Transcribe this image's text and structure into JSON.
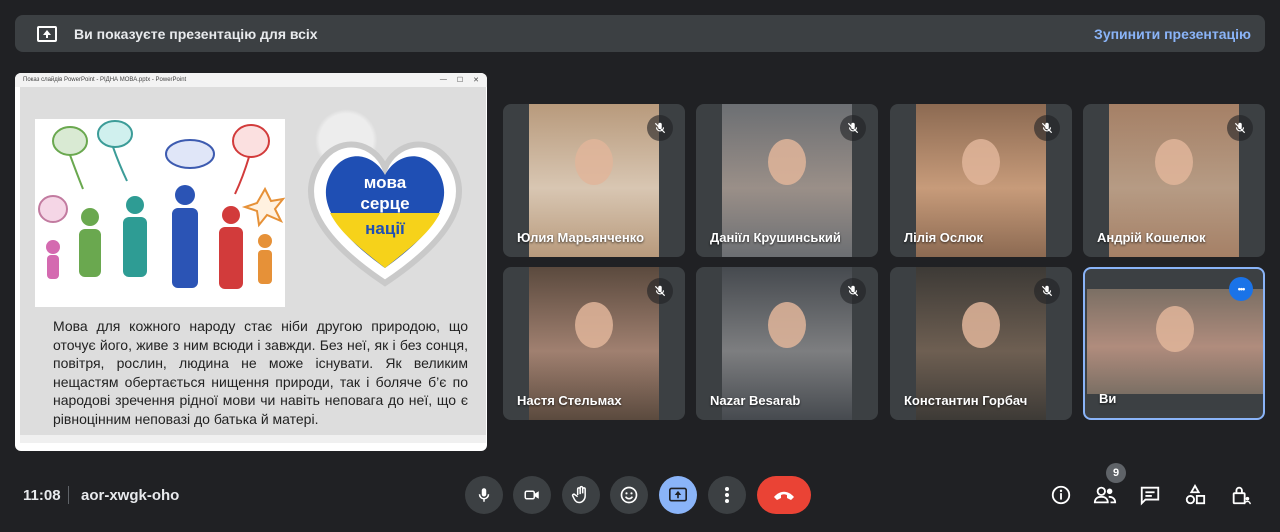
{
  "banner": {
    "text": "Ви показуєте презентацію для всіх",
    "stop_label": "Зупинити презентацію"
  },
  "presentation": {
    "window_title": "Показ слайдів PowerPoint - РІДНА МОВА.pptx - PowerPoint",
    "heart_text": "мова серце нації",
    "slide_text": "Мова для кожного народу стає ніби другою природою, що оточує його, живе з ним всюди і завжди. Без неї, як і без сонця, повітря, рослин, людина не може існувати. Як великим нещастям обертається нищення природи, так і боляче б’є по народові зречення рідної мови чи навіть неповага до неї, що є рівноцінним неповазі до батька й матері."
  },
  "participants": [
    {
      "name": "Юлия Марьянченко",
      "muted": true,
      "bg": "#b89a7c",
      "video": "#d8c6b2"
    },
    {
      "name": "Даніїл Крушинський",
      "muted": true,
      "bg": "#6c6f73",
      "video": "#9a8f88"
    },
    {
      "name": "Лілія Ослюк",
      "muted": true,
      "bg": "#8c6a52",
      "video": "#c79b7a"
    },
    {
      "name": "Андрій Кошелюк",
      "muted": true,
      "bg": "#a58066",
      "video": "#b69b84"
    },
    {
      "name": "Настя Стельмах",
      "muted": true,
      "bg": "#5b4a3e",
      "video": "#a08070"
    },
    {
      "name": "Nazar Besarab",
      "muted": true,
      "bg": "#464a4f",
      "video": "#7d7e80"
    },
    {
      "name": "Константин Горбач",
      "muted": true,
      "bg": "#3d3a36",
      "video": "#6e5f52"
    },
    {
      "name": "Ви",
      "muted": false,
      "bg": "#7b6f64",
      "video": "#b08c7d"
    }
  ],
  "footer": {
    "time": "11:08",
    "meeting_code": "aor-xwgk-oho",
    "participants_count": "9"
  },
  "colors": {
    "accent": "#8ab4f8",
    "end_call": "#ea4335",
    "background": "#202124"
  }
}
